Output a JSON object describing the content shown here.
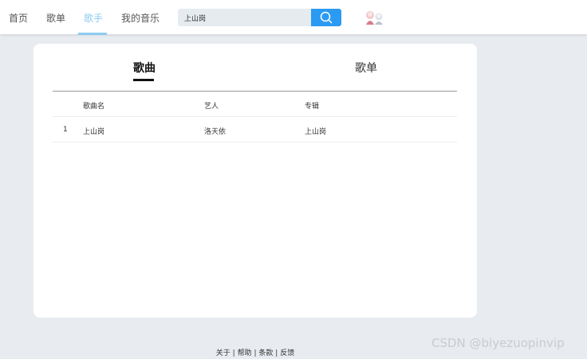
{
  "nav": {
    "items": [
      {
        "label": "首页"
      },
      {
        "label": "歌单"
      },
      {
        "label": "歌手"
      },
      {
        "label": "我的音乐"
      }
    ],
    "active_color": "#8ecbf0"
  },
  "search": {
    "value": "上山岗",
    "icon": "search-icon",
    "button_color": "#2b9af3"
  },
  "tabs": {
    "songs": "歌曲",
    "playlists": "歌单"
  },
  "table": {
    "headers": [
      "歌曲名",
      "艺人",
      "专辑"
    ],
    "rows": [
      {
        "index": "1",
        "name": "上山岗",
        "artist": "洛天依",
        "album": "上山岗"
      }
    ]
  },
  "footer": {
    "about": "关于",
    "help": "帮助",
    "terms": "条款",
    "feedback": "反馈",
    "sep": "|"
  },
  "watermark": "CSDN @biyezuopinvip"
}
